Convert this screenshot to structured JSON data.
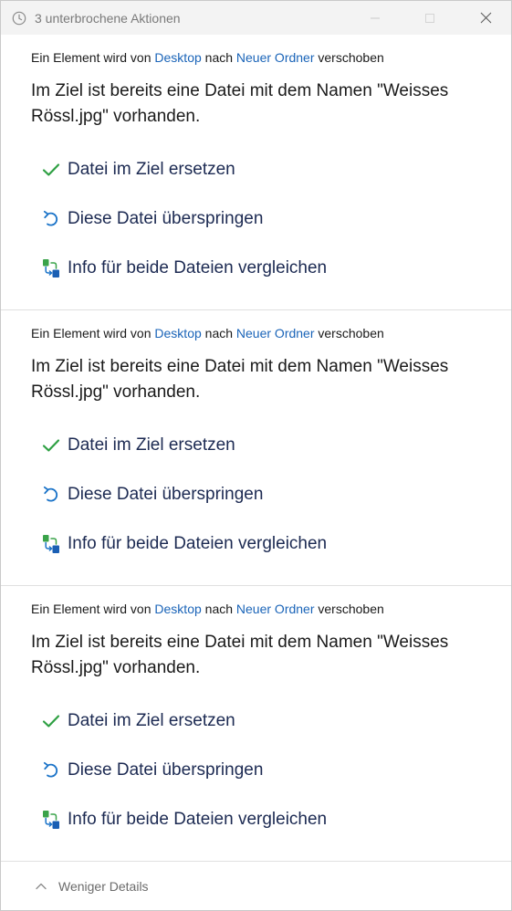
{
  "window": {
    "title": "3 unterbrochene Aktionen"
  },
  "conflicts": [
    {
      "info_prefix": "Ein Element wird von ",
      "source": "Desktop",
      "info_middle": " nach ",
      "destination": "Neuer Ordner",
      "info_suffix": " verschoben",
      "message": "Im Ziel ist bereits eine Datei mit dem Namen \"Weisses Rössl.jpg\" vorhanden.",
      "replace_label": "Datei im Ziel ersetzen",
      "skip_label": "Diese Datei überspringen",
      "compare_label": "Info für beide Dateien vergleichen"
    },
    {
      "info_prefix": "Ein Element wird von ",
      "source": "Desktop",
      "info_middle": " nach ",
      "destination": "Neuer Ordner",
      "info_suffix": " verschoben",
      "message": "Im Ziel ist bereits eine Datei mit dem Namen \"Weisses Rössl.jpg\" vorhanden.",
      "replace_label": "Datei im Ziel ersetzen",
      "skip_label": "Diese Datei überspringen",
      "compare_label": "Info für beide Dateien vergleichen"
    },
    {
      "info_prefix": "Ein Element wird von ",
      "source": "Desktop",
      "info_middle": " nach ",
      "destination": "Neuer Ordner",
      "info_suffix": " verschoben",
      "message": "Im Ziel ist bereits eine Datei mit dem Namen \"Weisses Rössl.jpg\" vorhanden.",
      "replace_label": "Datei im Ziel ersetzen",
      "skip_label": "Diese Datei überspringen",
      "compare_label": "Info für beide Dateien vergleichen"
    }
  ],
  "footer": {
    "details_label": "Weniger Details"
  },
  "icons": {
    "title": "clock-icon",
    "replace": "checkmark-icon",
    "skip": "undo-arrow-icon",
    "compare": "compare-files-icon",
    "details": "chevron-up-icon"
  },
  "colors": {
    "link": "#1a64b8",
    "check": "#2ea043",
    "skip": "#1a73c8",
    "option_text": "#1c2a52",
    "titlebar": "#f3f3f3"
  }
}
